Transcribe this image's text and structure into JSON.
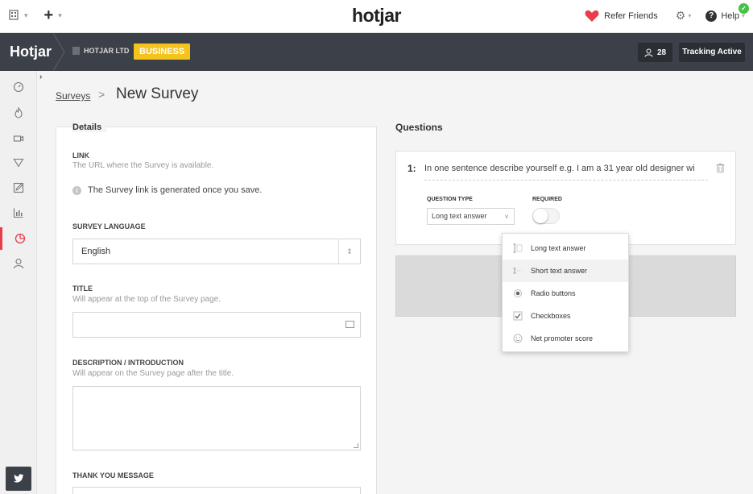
{
  "topbar": {
    "logo": "hotjar",
    "refer_label": "Refer Friends",
    "help_label": "Help"
  },
  "header": {
    "brand": "Hotjar",
    "org_name": "HOTJAR LTD",
    "plan_badge": "BUSINESS",
    "users_count": "28",
    "tracking_label": "Tracking Active"
  },
  "breadcrumb": {
    "parent": "Surveys",
    "separator": ">",
    "current": "New Survey"
  },
  "details": {
    "heading": "Details",
    "link": {
      "label": "LINK",
      "help": "The URL where the Survey is available.",
      "info": "The Survey link is generated once you save."
    },
    "language": {
      "label": "SURVEY LANGUAGE",
      "value": "English"
    },
    "title": {
      "label": "TITLE",
      "help": "Will appear at the top of the Survey page."
    },
    "description": {
      "label": "DESCRIPTION / INTRODUCTION",
      "help": "Will appear on the Survey page after the title."
    },
    "thankyou": {
      "label": "THANK YOU MESSAGE"
    }
  },
  "questions": {
    "heading": "Questions",
    "items": [
      {
        "number": "1:",
        "text": "In one sentence describe yourself e.g. I am a 31 year old designer wi",
        "type_label": "QUESTION TYPE",
        "type_value": "Long text answer",
        "required_label": "REQUIRED",
        "required": false
      }
    ]
  },
  "type_menu": {
    "highlighted_index": 1,
    "options": [
      {
        "label": "Long text answer",
        "icon": "long-text-icon"
      },
      {
        "label": "Short text answer",
        "icon": "short-text-icon"
      },
      {
        "label": "Radio buttons",
        "icon": "radio-icon"
      },
      {
        "label": "Checkboxes",
        "icon": "checkbox-icon"
      },
      {
        "label": "Net promoter score",
        "icon": "smiley-icon"
      }
    ]
  },
  "colors": {
    "dark_header": "#3c4049",
    "plan_badge": "#f4c31c",
    "accent_red": "#e83e4c",
    "tracking_check": "#45c143"
  }
}
